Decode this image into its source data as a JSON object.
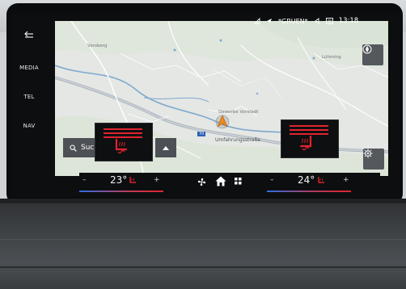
{
  "rail": {
    "back_icon": "back-arrow-icon",
    "items": [
      {
        "label": "MEDIA"
      },
      {
        "label": "TEL"
      },
      {
        "label": "NAV"
      }
    ]
  },
  "status": {
    "profile_label": "*GRUEN*",
    "time": "13:18",
    "icons": [
      "phone-signal-icon",
      "location-arrow-icon",
      "volume-icon",
      "message-icon"
    ]
  },
  "map": {
    "places": [
      {
        "name": "Vorsberg"
      },
      {
        "name": "Lühming"
      },
      {
        "name": "Gewerbe Vorstadt"
      }
    ],
    "road_label": "Umfahrungsstraße",
    "road_number": "70",
    "compass_icon": "compass-icon",
    "settings_icon": "gear-icon"
  },
  "search": {
    "label": "Suc",
    "icon": "search-icon",
    "expand_icon": "chevron-up-icon"
  },
  "seat_heating": {
    "left_level": 3,
    "right_level": 3,
    "active_color": "#e0242e"
  },
  "climate": {
    "left_minus": "–",
    "left_temp": "23°",
    "left_plus": "+",
    "right_minus": "–",
    "right_temp": "24°",
    "right_plus": "+",
    "fan_icon": "fan-icon",
    "home_icon": "home-icon",
    "apps_icon": "grid-icon"
  }
}
